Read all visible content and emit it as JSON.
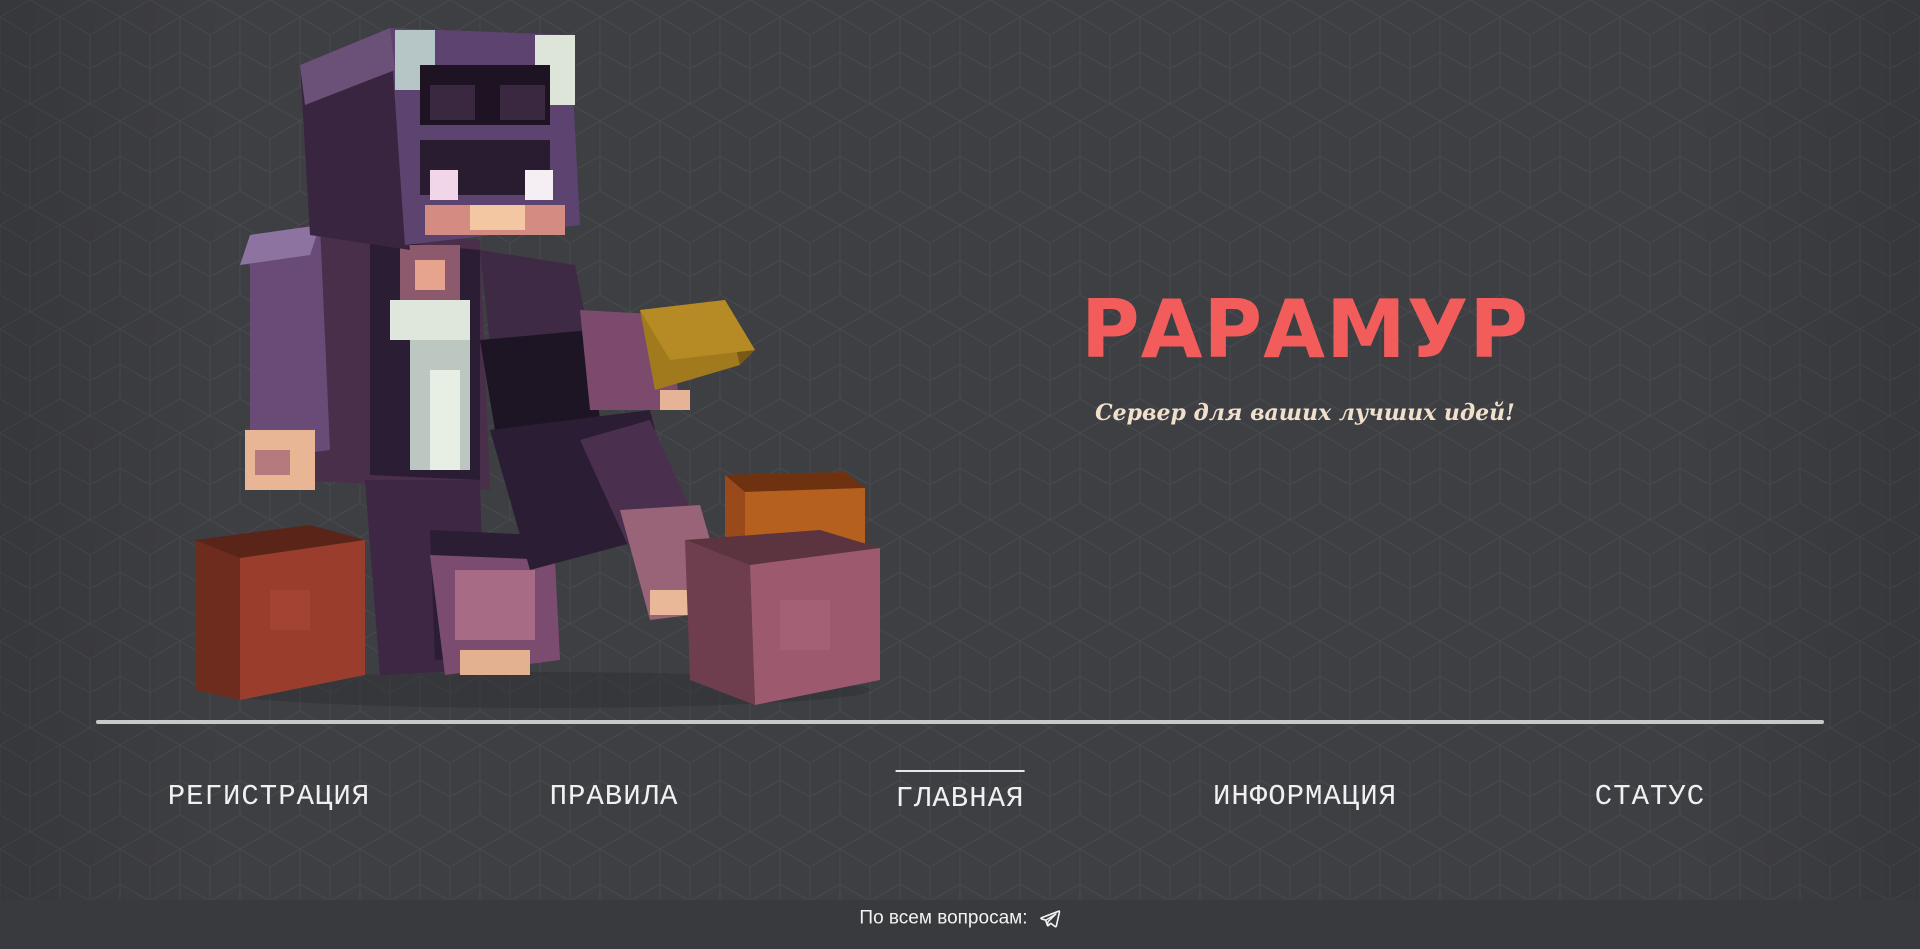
{
  "hero": {
    "title": "РАРАМУР",
    "subtitle": "Сервер для ваших лучших идей!",
    "title_color": "#f25c5a",
    "subtitle_color": "#f0e0cc",
    "illustration": "minecraft-character-with-blocks"
  },
  "nav": {
    "items": [
      {
        "label": "РЕГИСТРАЦИЯ",
        "active": false
      },
      {
        "label": "ПРАВИЛА",
        "active": false
      },
      {
        "label": "ГЛАВНАЯ",
        "active": true
      },
      {
        "label": "ИНФОРМАЦИЯ",
        "active": false
      },
      {
        "label": "СТАТУС",
        "active": false
      }
    ]
  },
  "footer": {
    "text": "По всем вопросам:",
    "icon": "telegram-icon"
  },
  "colors": {
    "background": "#3e3f43",
    "divider": "#c9c9c9",
    "nav_text": "#f0f0f0"
  }
}
